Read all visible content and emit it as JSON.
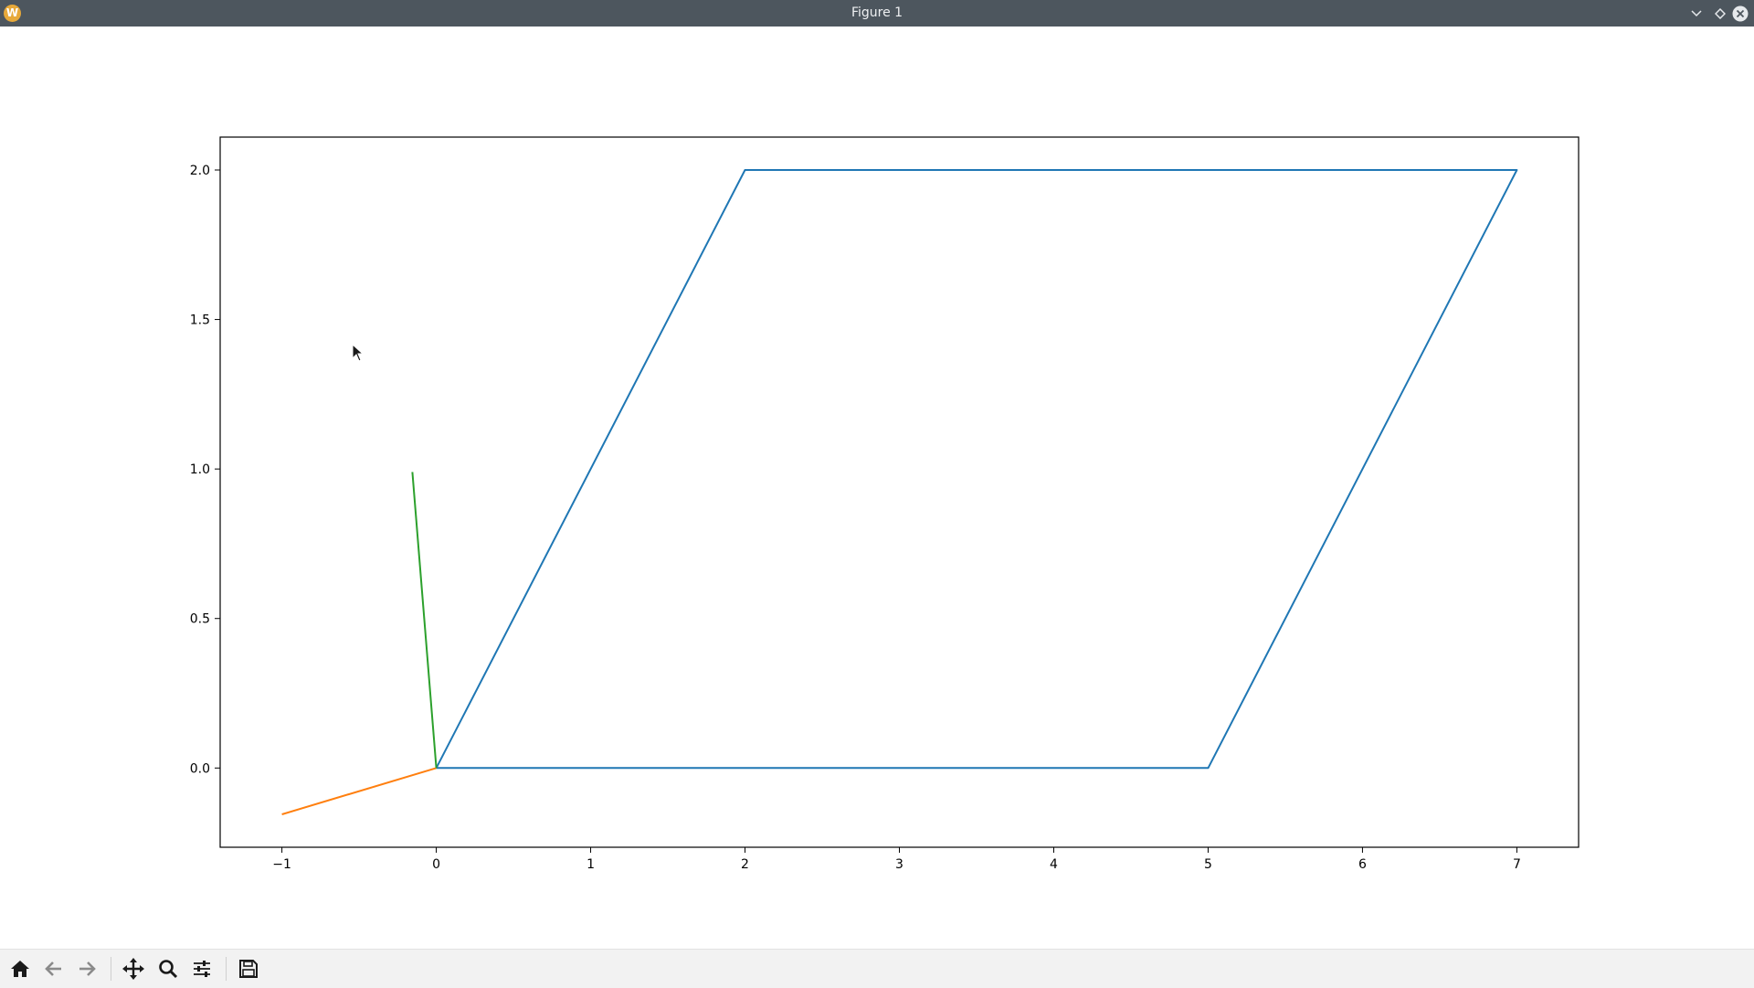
{
  "window": {
    "title": "Figure 1",
    "app_icon_letter": "W"
  },
  "icons": {
    "app": "app-logo-icon",
    "minimize": "chevron-down-icon",
    "maximize": "diamond-icon",
    "close": "close-icon"
  },
  "toolbar": {
    "buttons": [
      {
        "name": "home-button",
        "icon": "home-icon"
      },
      {
        "name": "back-button",
        "icon": "arrow-left-icon"
      },
      {
        "name": "forward-button",
        "icon": "arrow-right-icon"
      },
      {
        "name": "pan-button",
        "icon": "move-icon"
      },
      {
        "name": "zoom-button",
        "icon": "magnifier-icon"
      },
      {
        "name": "configure-subplots-button",
        "icon": "sliders-icon"
      },
      {
        "name": "save-button",
        "icon": "floppy-disk-icon"
      }
    ]
  },
  "chart_data": {
    "type": "line",
    "title": "",
    "xlabel": "",
    "ylabel": "",
    "xlim": [
      -1.4,
      7.4
    ],
    "ylim": [
      -0.265,
      2.11
    ],
    "xticks": [
      -1,
      0,
      1,
      2,
      3,
      4,
      5,
      6,
      7
    ],
    "yticks": [
      0.0,
      0.5,
      1.0,
      1.5,
      2.0
    ],
    "xtick_labels": [
      "−1",
      "0",
      "1",
      "2",
      "3",
      "4",
      "5",
      "6",
      "7"
    ],
    "ytick_labels": [
      "0.0",
      "0.5",
      "1.0",
      "1.5",
      "2.0"
    ],
    "grid": false,
    "legend": "none",
    "series": [
      {
        "color": "#1f77b4",
        "x": [
          0,
          5,
          7,
          2,
          0
        ],
        "y": [
          0,
          0,
          2,
          2,
          0
        ]
      },
      {
        "color": "#ff7f0e",
        "x": [
          0,
          -1
        ],
        "y": [
          0,
          -0.155
        ]
      },
      {
        "color": "#2ca02c",
        "x": [
          0,
          -0.155
        ],
        "y": [
          0,
          0.99
        ]
      }
    ]
  }
}
